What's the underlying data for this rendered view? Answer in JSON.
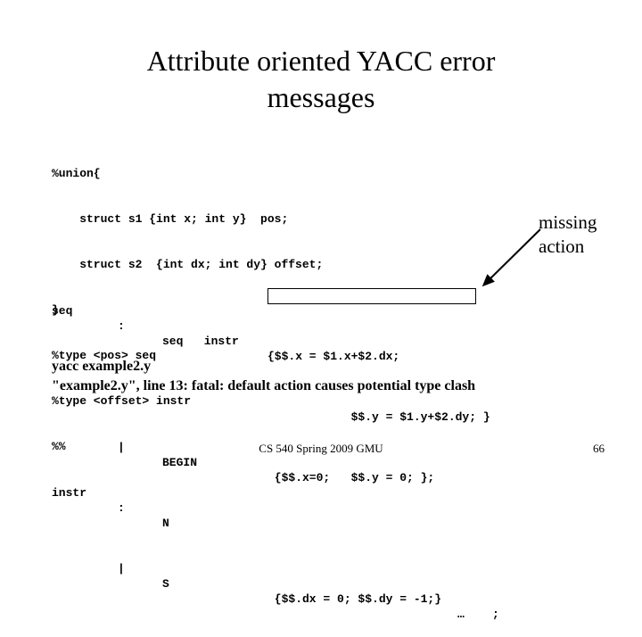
{
  "slide": {
    "title": "Attribute oriented YACC error\nmessages",
    "declarations": [
      "%union{",
      "    struct s1 {int x; int y}  pos;",
      "    struct s2  {int dx; int dy} offset;",
      "}",
      "%type <pos> seq",
      "%type <offset> instr",
      "%%"
    ],
    "rules": [
      {
        "lhs": "seq",
        "sep": ":",
        "rhs": "seq   instr",
        "action": "{$$.x = $1.x+$2.dx;",
        "action_cont": "",
        "tail": ""
      },
      {
        "lhs": "",
        "sep": "",
        "rhs": "",
        "action": "            $$.y = $1.y+$2.dy; }",
        "action_cont": "",
        "tail": ""
      },
      {
        "lhs": "",
        "sep": "|",
        "rhs": "BEGIN",
        "action": " {$$.x=0;   $$.y = 0; };",
        "action_cont": "",
        "tail": ""
      },
      {
        "lhs": "instr",
        "sep": ":",
        "rhs": "N",
        "action": "",
        "action_cont": "",
        "tail": ""
      },
      {
        "lhs": "",
        "sep": "|",
        "rhs": "S",
        "action": " {$$.dx = 0; $$.dy = -1;}",
        "action_cont": "",
        "tail": "…    ;"
      }
    ],
    "empty_action_box": {
      "label": ""
    },
    "callout": {
      "text": "missing\naction"
    },
    "terminal": [
      "yacc example2.y",
      "\"example2.y\", line 13: fatal: default action causes potential type clash"
    ],
    "footer": {
      "course": "CS 540 Spring 2009 GMU",
      "page": "66"
    },
    "colors": {
      "background": "#ffffff",
      "text": "#000000",
      "box_border": "#000000"
    }
  }
}
